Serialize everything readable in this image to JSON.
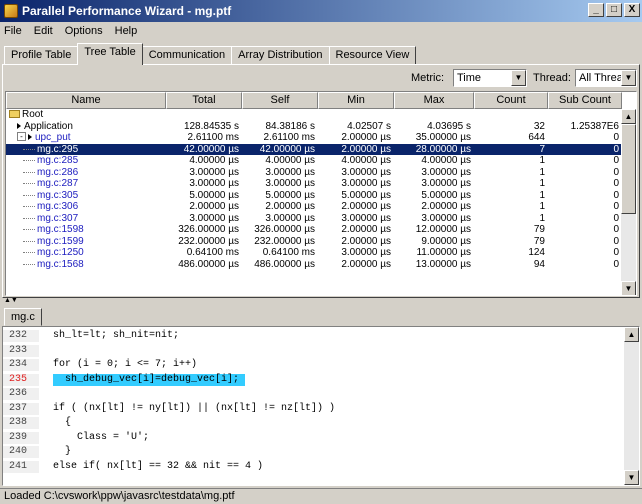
{
  "window": {
    "title": "Parallel Performance Wizard - mg.ptf",
    "buttons": [
      "_",
      "□",
      "X"
    ]
  },
  "menu": [
    "File",
    "Edit",
    "Options",
    "Help"
  ],
  "tabs": [
    "Profile Table",
    "Tree Table",
    "Communication",
    "Array Distribution",
    "Resource View"
  ],
  "active_tab": "Tree Table",
  "controls": {
    "metric_label": "Metric:",
    "metric_value": "Time",
    "thread_label": "Thread:",
    "thread_value": "All Threads"
  },
  "table": {
    "columns": [
      "Name",
      "Total",
      "Self",
      "Min",
      "Max",
      "Count",
      "Sub Count"
    ],
    "rows": [
      {
        "name": "Root",
        "total": "",
        "self": "",
        "min": "",
        "max": "",
        "count": "",
        "sub": "",
        "kind": "root"
      },
      {
        "name": "Application",
        "total": "128.84535 s",
        "self": "84.38186 s",
        "min": "4.02507 s",
        "max": "4.03695 s",
        "count": "32",
        "sub": "1.25387E6",
        "kind": "group"
      },
      {
        "name": "upc_put",
        "total": "2.61100 ms",
        "self": "2.61100 ms",
        "min": "2.00000 µs",
        "max": "35.00000 µs",
        "count": "644",
        "sub": "0",
        "kind": "expanded"
      },
      {
        "name": "mg.c:295",
        "total": "42.00000 µs",
        "self": "42.00000 µs",
        "min": "2.00000 µs",
        "max": "28.00000 µs",
        "count": "7",
        "sub": "0",
        "kind": "leaf",
        "selected": true
      },
      {
        "name": "mg.c:285",
        "total": "4.00000 µs",
        "self": "4.00000 µs",
        "min": "4.00000 µs",
        "max": "4.00000 µs",
        "count": "1",
        "sub": "0",
        "kind": "leaf"
      },
      {
        "name": "mg.c:286",
        "total": "3.00000 µs",
        "self": "3.00000 µs",
        "min": "3.00000 µs",
        "max": "3.00000 µs",
        "count": "1",
        "sub": "0",
        "kind": "leaf"
      },
      {
        "name": "mg.c:287",
        "total": "3.00000 µs",
        "self": "3.00000 µs",
        "min": "3.00000 µs",
        "max": "3.00000 µs",
        "count": "1",
        "sub": "0",
        "kind": "leaf"
      },
      {
        "name": "mg.c:305",
        "total": "5.00000 µs",
        "self": "5.00000 µs",
        "min": "5.00000 µs",
        "max": "5.00000 µs",
        "count": "1",
        "sub": "0",
        "kind": "leaf"
      },
      {
        "name": "mg.c:306",
        "total": "2.00000 µs",
        "self": "2.00000 µs",
        "min": "2.00000 µs",
        "max": "2.00000 µs",
        "count": "1",
        "sub": "0",
        "kind": "leaf"
      },
      {
        "name": "mg.c:307",
        "total": "3.00000 µs",
        "self": "3.00000 µs",
        "min": "3.00000 µs",
        "max": "3.00000 µs",
        "count": "1",
        "sub": "0",
        "kind": "leaf"
      },
      {
        "name": "mg.c:1598",
        "total": "326.00000 µs",
        "self": "326.00000 µs",
        "min": "2.00000 µs",
        "max": "12.00000 µs",
        "count": "79",
        "sub": "0",
        "kind": "leaf"
      },
      {
        "name": "mg.c:1599",
        "total": "232.00000 µs",
        "self": "232.00000 µs",
        "min": "2.00000 µs",
        "max": "9.00000 µs",
        "count": "79",
        "sub": "0",
        "kind": "leaf"
      },
      {
        "name": "mg.c:1250",
        "total": "0.64100 ms",
        "self": "0.64100 ms",
        "min": "3.00000 µs",
        "max": "11.00000 µs",
        "count": "124",
        "sub": "0",
        "kind": "leaf"
      },
      {
        "name": "mg.c:1568",
        "total": "486.00000 µs",
        "self": "486.00000 µs",
        "min": "2.00000 µs",
        "max": "13.00000 µs",
        "count": "94",
        "sub": "0",
        "kind": "leaf"
      }
    ]
  },
  "file_tab": "mg.c",
  "code_lines": [
    {
      "n": "232",
      "text": "sh_lt=lt; sh_nit=nit;"
    },
    {
      "n": "233",
      "text": ""
    },
    {
      "n": "234",
      "text": "for (i = 0; i <= 7; i++)"
    },
    {
      "n": "235",
      "text": "  sh_debug_vec[i]=debug_vec[i];",
      "highlight": true
    },
    {
      "n": "236",
      "text": ""
    },
    {
      "n": "237",
      "text": "if ( (nx[lt] != ny[lt]) || (nx[lt] != nz[lt]) )"
    },
    {
      "n": "238",
      "text": "  {"
    },
    {
      "n": "239",
      "text": "    Class = 'U';"
    },
    {
      "n": "240",
      "text": "  }"
    },
    {
      "n": "241",
      "text": "else if( nx[lt] == 32 && nit == 4 )"
    }
  ],
  "status": "Loaded C:\\cvswork\\ppw\\javasrc\\testdata\\mg.ptf",
  "colors": {
    "selection": "#0a246a",
    "highlight": "#33ccff",
    "link": "#2020c0",
    "hl_line_number": "#e02020"
  }
}
